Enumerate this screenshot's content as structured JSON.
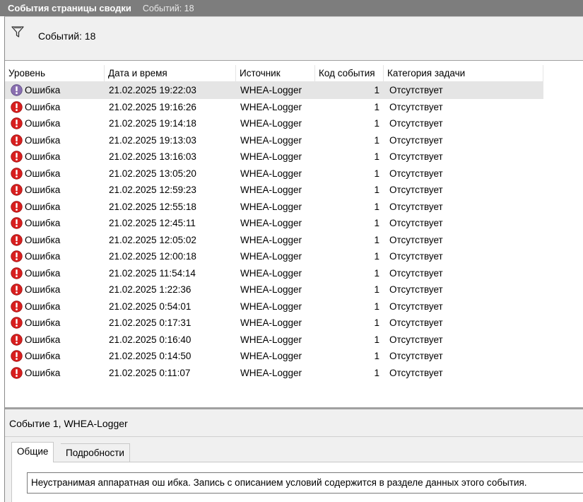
{
  "window": {
    "title": "События страницы сводки",
    "event_count_label": "Событий: 18"
  },
  "filter": {
    "icon": "filter-icon",
    "count_label": "Событий: 18"
  },
  "table": {
    "columns": [
      "Уровень",
      "Дата и время",
      "Источник",
      "Код события",
      "Категория задачи"
    ],
    "rows": [
      {
        "level": "Ошибка",
        "datetime": "21.02.2025 19:22:03",
        "source": "WHEA-Logger",
        "code": "1",
        "category": "Отсутствует"
      },
      {
        "level": "Ошибка",
        "datetime": "21.02.2025 19:16:26",
        "source": "WHEA-Logger",
        "code": "1",
        "category": "Отсутствует"
      },
      {
        "level": "Ошибка",
        "datetime": "21.02.2025 19:14:18",
        "source": "WHEA-Logger",
        "code": "1",
        "category": "Отсутствует"
      },
      {
        "level": "Ошибка",
        "datetime": "21.02.2025 19:13:03",
        "source": "WHEA-Logger",
        "code": "1",
        "category": "Отсутствует"
      },
      {
        "level": "Ошибка",
        "datetime": "21.02.2025 13:16:03",
        "source": "WHEA-Logger",
        "code": "1",
        "category": "Отсутствует"
      },
      {
        "level": "Ошибка",
        "datetime": "21.02.2025 13:05:20",
        "source": "WHEA-Logger",
        "code": "1",
        "category": "Отсутствует"
      },
      {
        "level": "Ошибка",
        "datetime": "21.02.2025 12:59:23",
        "source": "WHEA-Logger",
        "code": "1",
        "category": "Отсутствует"
      },
      {
        "level": "Ошибка",
        "datetime": "21.02.2025 12:55:18",
        "source": "WHEA-Logger",
        "code": "1",
        "category": "Отсутствует"
      },
      {
        "level": "Ошибка",
        "datetime": "21.02.2025 12:45:11",
        "source": "WHEA-Logger",
        "code": "1",
        "category": "Отсутствует"
      },
      {
        "level": "Ошибка",
        "datetime": "21.02.2025 12:05:02",
        "source": "WHEA-Logger",
        "code": "1",
        "category": "Отсутствует"
      },
      {
        "level": "Ошибка",
        "datetime": "21.02.2025 12:00:18",
        "source": "WHEA-Logger",
        "code": "1",
        "category": "Отсутствует"
      },
      {
        "level": "Ошибка",
        "datetime": "21.02.2025 11:54:14",
        "source": "WHEA-Logger",
        "code": "1",
        "category": "Отсутствует"
      },
      {
        "level": "Ошибка",
        "datetime": "21.02.2025 1:22:36",
        "source": "WHEA-Logger",
        "code": "1",
        "category": "Отсутствует"
      },
      {
        "level": "Ошибка",
        "datetime": "21.02.2025 0:54:01",
        "source": "WHEA-Logger",
        "code": "1",
        "category": "Отсутствует"
      },
      {
        "level": "Ошибка",
        "datetime": "21.02.2025 0:17:31",
        "source": "WHEA-Logger",
        "code": "1",
        "category": "Отсутствует"
      },
      {
        "level": "Ошибка",
        "datetime": "21.02.2025 0:16:40",
        "source": "WHEA-Logger",
        "code": "1",
        "category": "Отсутствует"
      },
      {
        "level": "Ошибка",
        "datetime": "21.02.2025 0:14:50",
        "source": "WHEA-Logger",
        "code": "1",
        "category": "Отсутствует"
      },
      {
        "level": "Ошибка",
        "datetime": "21.02.2025 0:11:07",
        "source": "WHEA-Logger",
        "code": "1",
        "category": "Отсутствует"
      }
    ],
    "selected_row": 0
  },
  "detail": {
    "title": "Событие 1, WHEA-Logger",
    "tabs": [
      "Общие",
      "Подробности"
    ],
    "active_tab": 0,
    "description": "Неустранимая аппаратная ош ибка. Запись с описанием условий содержится в разделе данных этого события."
  },
  "colors": {
    "titlebar_bg": "#7d7d7d",
    "error_red": "#d81e1e",
    "selected_row_bg": "#e5e5e5"
  }
}
